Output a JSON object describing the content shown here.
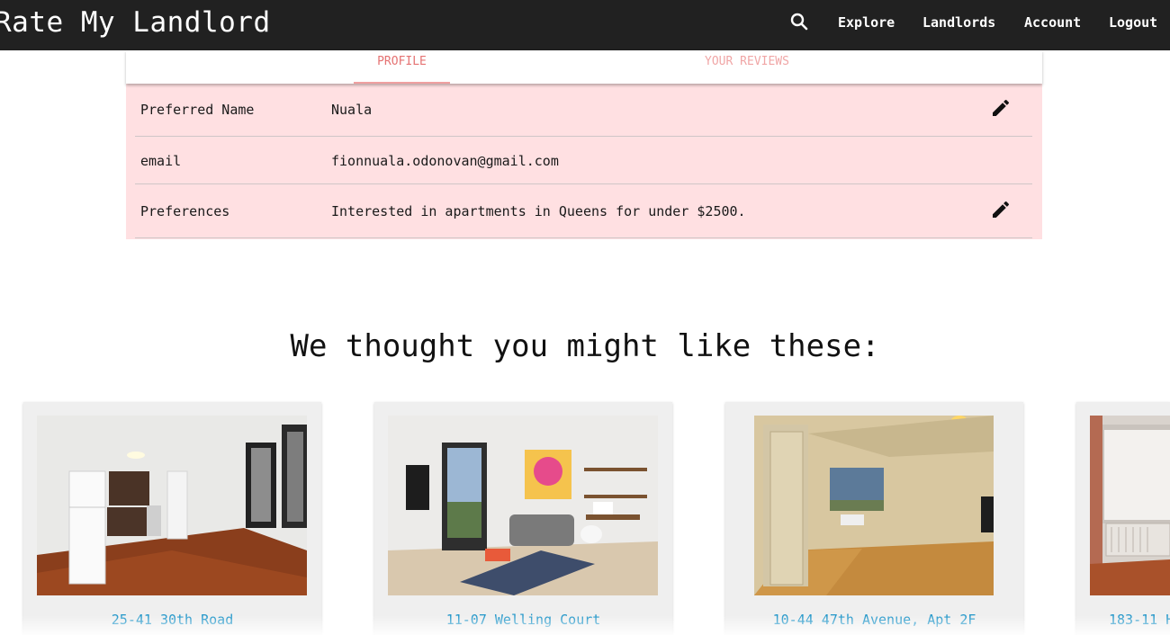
{
  "header": {
    "brand": "Rate My Landlord",
    "nav": [
      "Explore",
      "Landlords",
      "Account",
      "Logout"
    ]
  },
  "tabs": {
    "profile": "PROFILE",
    "reviews": "YOUR REVIEWS"
  },
  "profile": {
    "rows": [
      {
        "label": "Preferred Name",
        "value": "Nuala"
      },
      {
        "label": "email",
        "value": "fionnuala.odonovan@gmail.com"
      },
      {
        "label": "Preferences",
        "value": "Interested in apartments in Queens for under $2500."
      }
    ]
  },
  "recommendations": {
    "heading": "We thought you might like these:",
    "items": [
      {
        "title": "25-41 30th Road"
      },
      {
        "title": "11-07 Welling Court"
      },
      {
        "title": "10-44 47th Avenue, Apt 2F"
      },
      {
        "title": "183-11 H"
      }
    ]
  },
  "colors": {
    "topbar": "#212121",
    "accent": "#e57373",
    "row_background": "#ffe0e2",
    "link": "#2196c9"
  },
  "icons": [
    "search-icon",
    "pencil-icon"
  ]
}
